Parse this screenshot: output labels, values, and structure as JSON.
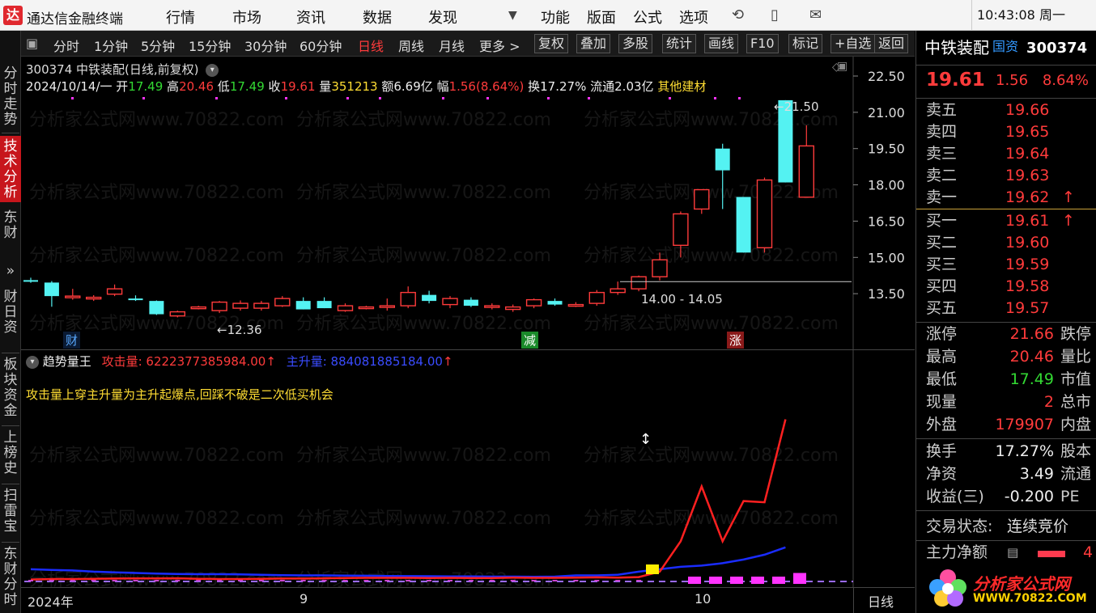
{
  "app": {
    "logo_char": "达",
    "title": "通达信金融终端"
  },
  "menu": [
    "行情",
    "市场",
    "资讯",
    "数据",
    "发现"
  ],
  "menu_right": [
    "功能",
    "版面",
    "公式",
    "选项"
  ],
  "clock": "10:43:08 周一",
  "left_tabs": [
    {
      "label": "分时走势",
      "active": false
    },
    {
      "label": "技术分析",
      "active": true
    },
    {
      "label": "东财",
      "active": false
    },
    {
      "label": "»",
      "active": false
    },
    {
      "label": "财日资",
      "active": false
    },
    {
      "label": "板块资金",
      "active": false
    },
    {
      "label": "上榜史",
      "active": false
    },
    {
      "label": "扫雷宝",
      "active": false
    },
    {
      "label": "东财分时",
      "active": false
    }
  ],
  "periods": [
    {
      "label": "分时",
      "active": false
    },
    {
      "label": "1分钟",
      "active": false
    },
    {
      "label": "5分钟",
      "active": false
    },
    {
      "label": "15分钟",
      "active": false
    },
    {
      "label": "30分钟",
      "active": false
    },
    {
      "label": "60分钟",
      "active": false
    },
    {
      "label": "日线",
      "active": true
    },
    {
      "label": "周线",
      "active": false
    },
    {
      "label": "月线",
      "active": false
    },
    {
      "label": "更多 >",
      "active": false
    }
  ],
  "tools": [
    "复权",
    "叠加",
    "多股",
    "统计",
    "画线",
    "F10",
    "标记",
    "+自选",
    "返回"
  ],
  "chart_header": {
    "code_name": "300374 中铁装配(日线,前复权)",
    "date": "2024/10/14/一",
    "open_label": "开",
    "open": "17.49",
    "high_label": "高",
    "high": "20.46",
    "low_label": "低",
    "low": "17.49",
    "close_label": "收",
    "close": "19.61",
    "vol_label": "量",
    "vol": "351213",
    "amt_label": "额",
    "amt": "6.69亿",
    "chg_label": "幅",
    "chg": "1.56(8.64%)",
    "turn_label": "换",
    "turn": "17.27%",
    "float_label": "流通",
    "float": "2.03亿",
    "sector": "其他建材"
  },
  "watermark": "分析家公式网www.70822.com",
  "chart_annotations": {
    "high_mark": "21.50",
    "low_mark": "12.36",
    "range_label": "14.00 - 14.05",
    "tag_cai": "财",
    "tag_jian": "减",
    "tag_zhang": "涨"
  },
  "indicator": {
    "name": "趋势量王",
    "attack_label": "攻击量:",
    "attack_value": "6222377385984.00",
    "main_label": "主升量:",
    "main_value": "884081885184.00",
    "arrow": "↑",
    "note": "攻击量上穿主升量为主升起爆点,回踩不破是二次低买机会"
  },
  "axis": {
    "prices": [
      "22.50",
      "21.00",
      "19.50",
      "18.00",
      "16.50",
      "15.00",
      "13.50"
    ],
    "dates": [
      "2024年",
      "9",
      "10"
    ],
    "period_label": "日线"
  },
  "chart_data": {
    "type": "candlestick",
    "y_range": [
      12.0,
      22.5
    ],
    "candles": [
      [
        14.06,
        14.16,
        13.95,
        14.0
      ],
      [
        13.96,
        14.02,
        12.96,
        13.4
      ],
      [
        13.36,
        13.7,
        13.25,
        13.4
      ],
      [
        13.33,
        13.44,
        13.2,
        13.35
      ],
      [
        13.48,
        13.88,
        13.4,
        13.7
      ],
      [
        13.3,
        13.43,
        13.2,
        13.25
      ],
      [
        13.2,
        13.22,
        12.62,
        12.65
      ],
      [
        12.58,
        12.8,
        12.52,
        12.75
      ],
      [
        12.88,
        13.0,
        12.85,
        12.95
      ],
      [
        12.8,
        13.2,
        12.7,
        13.15
      ],
      [
        12.9,
        13.22,
        12.8,
        13.1
      ],
      [
        12.9,
        13.2,
        12.8,
        13.1
      ],
      [
        13.0,
        13.4,
        12.95,
        13.3
      ],
      [
        13.2,
        13.35,
        12.85,
        12.85
      ],
      [
        13.2,
        13.35,
        12.9,
        12.9
      ],
      [
        12.8,
        13.1,
        12.75,
        13.0
      ],
      [
        12.95,
        13.0,
        12.85,
        12.95
      ],
      [
        12.95,
        13.3,
        12.8,
        13.0
      ],
      [
        13.0,
        13.8,
        12.9,
        13.55
      ],
      [
        13.45,
        13.62,
        13.1,
        13.2
      ],
      [
        13.05,
        13.4,
        12.9,
        13.3
      ],
      [
        13.25,
        13.35,
        12.95,
        13.0
      ],
      [
        12.95,
        13.1,
        12.85,
        13.0
      ],
      [
        12.85,
        13.05,
        12.75,
        12.95
      ],
      [
        13.0,
        13.3,
        12.9,
        13.25
      ],
      [
        13.2,
        13.3,
        13.0,
        13.05
      ],
      [
        13.05,
        13.15,
        12.95,
        13.05
      ],
      [
        13.1,
        13.65,
        13.0,
        13.55
      ],
      [
        13.55,
        14.0,
        13.45,
        13.7
      ],
      [
        13.7,
        14.25,
        13.6,
        14.2
      ],
      [
        14.2,
        15.2,
        14.05,
        14.9
      ],
      [
        15.5,
        16.9,
        15.0,
        16.8
      ],
      [
        17.0,
        17.8,
        16.8,
        17.8
      ],
      [
        19.5,
        19.7,
        17.0,
        18.6
      ],
      [
        17.5,
        17.5,
        15.2,
        15.2
      ],
      [
        15.4,
        18.3,
        15.2,
        18.2
      ],
      [
        21.5,
        21.5,
        18.1,
        18.1
      ],
      [
        17.49,
        20.46,
        17.49,
        19.61
      ]
    ],
    "attack_line": [
      0.16,
      0.2,
      0.2,
      0.22,
      0.24,
      0.25,
      0.25,
      0.26,
      0.22,
      0.2,
      0.2,
      0.22,
      0.24,
      0.24,
      0.26,
      0.28,
      0.3,
      0.3,
      0.3,
      0.28,
      0.3,
      0.28,
      0.28,
      0.32,
      0.3,
      0.3,
      0.32,
      0.34,
      0.32,
      0.36,
      0.8,
      3.3,
      7.8,
      3.3,
      6.6,
      6.5,
      13.3
    ],
    "main_line": [
      1.0,
      0.95,
      0.9,
      0.8,
      0.75,
      0.7,
      0.65,
      0.62,
      0.6,
      0.6,
      0.58,
      0.55,
      0.52,
      0.5,
      0.5,
      0.48,
      0.47,
      0.45,
      0.44,
      0.43,
      0.42,
      0.42,
      0.4,
      0.4,
      0.38,
      0.4,
      0.5,
      0.5,
      0.55,
      0.8,
      1.0,
      1.2,
      1.3,
      1.5,
      1.8,
      2.2,
      2.8
    ],
    "bars_magenta": [
      0.3,
      0.3,
      0.3,
      0.3,
      0.3,
      0.35
    ],
    "ind_range": [
      0,
      15
    ]
  },
  "quote": {
    "name": "中铁装配",
    "tag": "国资",
    "code": "300374",
    "price": "19.61",
    "change": "1.56",
    "pct": "8.64%",
    "asks": [
      {
        "label": "卖五",
        "price": "19.66",
        "arrow": ""
      },
      {
        "label": "卖四",
        "price": "19.65",
        "arrow": ""
      },
      {
        "label": "卖三",
        "price": "19.64",
        "arrow": ""
      },
      {
        "label": "卖二",
        "price": "19.63",
        "arrow": ""
      },
      {
        "label": "卖一",
        "price": "19.62",
        "arrow": "↑"
      }
    ],
    "bids": [
      {
        "label": "买一",
        "price": "19.61",
        "arrow": "↑"
      },
      {
        "label": "买二",
        "price": "19.60",
        "arrow": ""
      },
      {
        "label": "买三",
        "price": "19.59",
        "arrow": ""
      },
      {
        "label": "买四",
        "price": "19.58",
        "arrow": ""
      },
      {
        "label": "买五",
        "price": "19.57",
        "arrow": ""
      }
    ],
    "stats": [
      {
        "label": "涨停",
        "value": "21.66",
        "color": "red",
        "label2": "跌停"
      },
      {
        "label": "最高",
        "value": "20.46",
        "color": "red",
        "label2": "量比"
      },
      {
        "label": "最低",
        "value": "17.49",
        "color": "green",
        "label2": "市值"
      },
      {
        "label": "现量",
        "value": "2",
        "color": "red",
        "label2": "总市"
      },
      {
        "label": "外盘",
        "value": "179907",
        "color": "red",
        "label2": "内盘"
      }
    ],
    "stats2": [
      {
        "label": "换手",
        "value": "17.27%",
        "label2": "股本"
      },
      {
        "label": "净资",
        "value": "3.49",
        "label2": "流通"
      },
      {
        "label": "收益(三)",
        "value": "-0.200",
        "label2": "PE"
      }
    ],
    "trade_state_label": "交易状态:",
    "trade_state": "连续竞价",
    "main_flow_label": "主力净额",
    "main_flow_value": "4",
    "brand_name": "分析家公式网",
    "brand_url": "WWW.70822.COM"
  }
}
